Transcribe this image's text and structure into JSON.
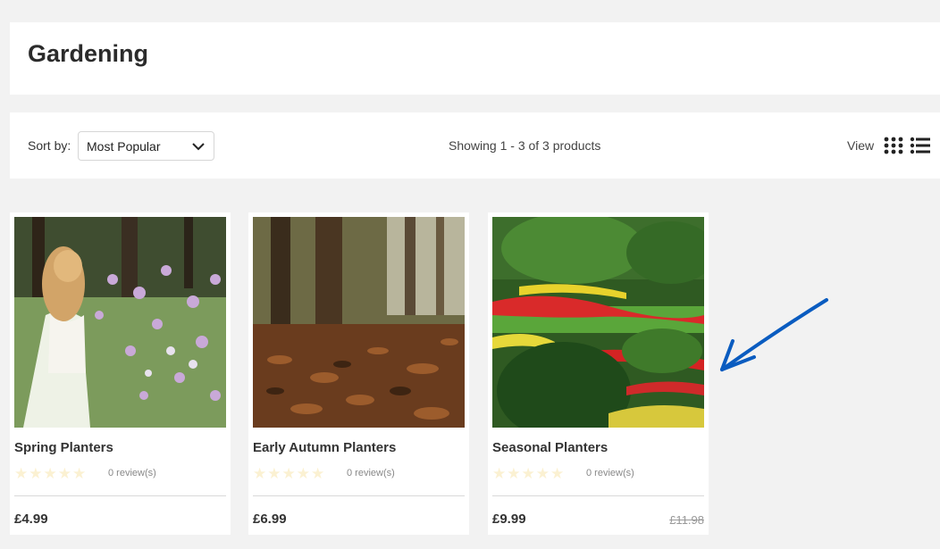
{
  "page": {
    "title": "Gardening"
  },
  "toolbar": {
    "sort_label": "Sort by:",
    "sort_value": "Most Popular",
    "showing": "Showing 1 - 3 of 3 products",
    "view_label": "View"
  },
  "products": [
    {
      "name": "Spring Planters",
      "reviews": "0 review(s)",
      "price": "£4.99",
      "rating": 0
    },
    {
      "name": "Early Autumn Planters",
      "reviews": "0 review(s)",
      "price": "£6.99",
      "rating": 0
    },
    {
      "name": "Seasonal Planters",
      "reviews": "0 review(s)",
      "price": "£9.99",
      "old_price": "£11.98",
      "rating": 0
    }
  ],
  "icons": {
    "sort": "chevron-down-icon",
    "grid_view": "grid-view-icon",
    "list_view": "list-view-icon",
    "annotation": "arrow-annotation-icon"
  },
  "colors": {
    "arrow": "#0a5cc0",
    "star_empty": "#fbf1d2"
  }
}
